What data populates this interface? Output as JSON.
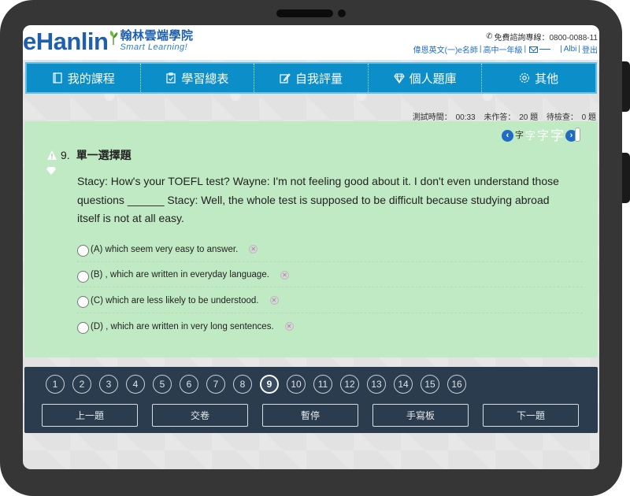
{
  "header": {
    "logo_text": "eHanlin",
    "logo_cn": "翰林雲端學院",
    "logo_sub": "Smart Learning!",
    "hotline": "免費諮詢專線：0800-0088-11",
    "user_links": [
      "偉恩英文(一)e名師",
      "高中一年級",
      "Albi",
      "登出"
    ]
  },
  "nav": {
    "items": [
      {
        "label": "我的課程",
        "icon": "book-icon"
      },
      {
        "label": "學習總表",
        "icon": "clipboard-icon"
      },
      {
        "label": "自我評量",
        "icon": "edit-icon"
      },
      {
        "label": "個人題庫",
        "icon": "diamond-icon"
      },
      {
        "label": "其他",
        "icon": "gear-icon"
      }
    ]
  },
  "stats": {
    "time_label": "測試時間：",
    "time_value": "00:33",
    "unanswered_label": "未作答：",
    "unanswered_value": "20 題",
    "pending_label": "待檢查：",
    "pending_value": "0 題"
  },
  "font_control": {
    "sizes": [
      "字",
      "字",
      "字",
      "字"
    ]
  },
  "question": {
    "number": "9.",
    "type": "單一選擇題",
    "text_lines": [
      "Stacy: How's your TOEFL test?  Wayne: I'm not feeling good about it.  I don't even understand those",
      "questions ______  Stacy: Well, the whole test is supposed to be difficult because studying abroad",
      "itself is not at all easy."
    ],
    "options": [
      "(A) which seem very easy to answer.",
      "(B) , which are written in everyday language.",
      "(C) which are less likely to be understood.",
      "(D) , which are written in very long sentences."
    ]
  },
  "navigator": {
    "numbers": [
      "1",
      "2",
      "3",
      "4",
      "5",
      "6",
      "7",
      "8",
      "9",
      "10",
      "11",
      "12",
      "13",
      "14",
      "15",
      "16"
    ],
    "active": "9",
    "buttons": [
      "上一題",
      "交卷",
      "暫停",
      "手寫板",
      "下一題"
    ]
  },
  "colors": {
    "nav_bg": "#0c8fc9",
    "question_bg": "#c0eac3",
    "bottom_bg": "#2b3c4e",
    "brand_blue": "#1e5fb0"
  }
}
